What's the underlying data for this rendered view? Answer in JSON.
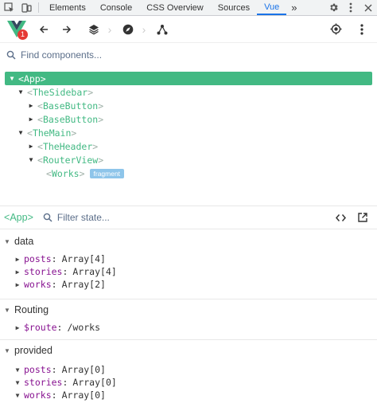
{
  "devtools_tabs": [
    "Elements",
    "Console",
    "CSS Overview",
    "Sources",
    "Vue"
  ],
  "active_tab": "Vue",
  "more_tabs_glyph": "»",
  "toolbar": {
    "badge_count": "1",
    "brand_color": "#42b983"
  },
  "component_search": {
    "placeholder": "Find components..."
  },
  "tree": [
    {
      "name": "App",
      "depth": 0,
      "expanded": true,
      "selected": true
    },
    {
      "name": "TheSidebar",
      "depth": 1,
      "expanded": true
    },
    {
      "name": "BaseButton",
      "depth": 2,
      "expanded": false
    },
    {
      "name": "BaseButton",
      "depth": 2,
      "expanded": false
    },
    {
      "name": "TheMain",
      "depth": 1,
      "expanded": true
    },
    {
      "name": "TheHeader",
      "depth": 2,
      "expanded": false
    },
    {
      "name": "RouterView",
      "depth": 2,
      "expanded": true
    },
    {
      "name": "Works",
      "depth": 3,
      "leaf": true,
      "badge": "fragment"
    }
  ],
  "state": {
    "selected_component": "App",
    "filter_placeholder": "Filter state...",
    "sections": [
      {
        "title": "data",
        "props": [
          {
            "key": "posts",
            "value": "Array[4]",
            "expanded": false
          },
          {
            "key": "stories",
            "value": "Array[4]",
            "expanded": false
          },
          {
            "key": "works",
            "value": "Array[2]",
            "expanded": false
          }
        ]
      },
      {
        "title": "Routing",
        "props": [
          {
            "key": "$route",
            "value": "/works",
            "expanded": false
          }
        ]
      },
      {
        "title": "provided",
        "props": [
          {
            "key": "posts",
            "value": "Array[0]",
            "expanded": true
          },
          {
            "key": "stories",
            "value": "Array[0]",
            "expanded": true
          },
          {
            "key": "works",
            "value": "Array[0]",
            "expanded": true
          }
        ]
      }
    ]
  }
}
